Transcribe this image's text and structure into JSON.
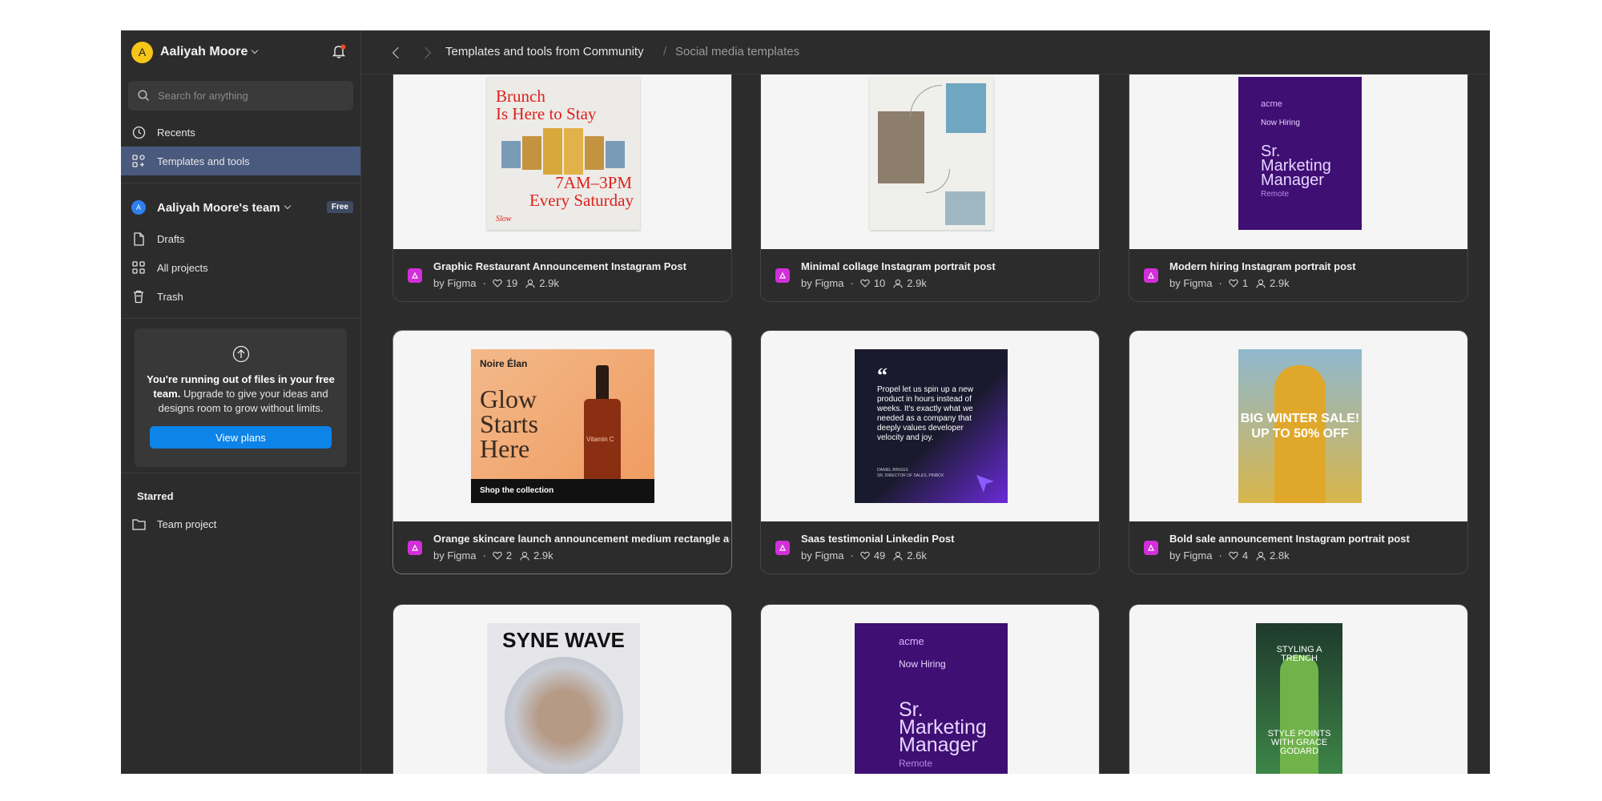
{
  "user": {
    "initial": "A",
    "name": "Aaliyah Moore"
  },
  "search": {
    "placeholder": "Search for anything"
  },
  "nav": {
    "recents": "Recents",
    "templates": "Templates and tools"
  },
  "team": {
    "initial": "A",
    "name": "Aaliyah Moore's team",
    "badge": "Free",
    "drafts": "Drafts",
    "all_projects": "All projects",
    "trash": "Trash"
  },
  "upgrade": {
    "bold": "You're running out of files in your free team.",
    "text": " Upgrade to give your ideas and designs room to grow without limits.",
    "button": "View plans"
  },
  "starred": {
    "title": "Starred",
    "items": [
      "Team project"
    ]
  },
  "breadcrumb": {
    "parent": "Templates and tools from Community",
    "separator": "/",
    "current": "Social media templates"
  },
  "colors": {
    "accent": "#0d84e8",
    "active_nav": "#4a5a7e",
    "figma_icon": "#d32fd9"
  },
  "cards": [
    {
      "title": "Graphic Restaurant Announcement Instagram Post",
      "by": "by Figma",
      "likes": "19",
      "users": "2.9k",
      "poster": {
        "l1": "Brunch",
        "l2": "Is Here to Stay",
        "l3": "7AM–3PM",
        "l4": "Every Saturday",
        "brand": "Slow"
      }
    },
    {
      "title": "Minimal collage Instagram portrait post",
      "by": "by Figma",
      "likes": "10",
      "users": "2.9k"
    },
    {
      "title": "Modern hiring Instagram portrait post",
      "by": "by Figma",
      "likes": "1",
      "users": "2.9k",
      "poster": {
        "brand": "acme",
        "l1": "Now Hiring",
        "l2": "Sr.",
        "l3": "Marketing",
        "l4": "Manager",
        "l5": "Remote"
      }
    },
    {
      "title": "Orange skincare launch announcement medium rectangle ad",
      "by": "by Figma",
      "likes": "2",
      "users": "2.9k",
      "poster": {
        "brand": "Noire Élan",
        "l1": "Glow",
        "l2": "Starts",
        "l3": "Here",
        "cta": "Shop the collection",
        "bottle": "Vitamin C"
      }
    },
    {
      "title": "Saas testimonial Linkedin Post",
      "by": "by Figma",
      "likes": "49",
      "users": "2.6k",
      "poster": {
        "quote": "Propel let us spin up a new product in hours instead of weeks. It's exactly what we needed as a company that deeply values developer velocity and joy.",
        "name": "DANIEL BRIGGS",
        "role": "SR. DIRECTOR OF SALES, PINBOX"
      }
    },
    {
      "title": "Bold sale announcement Instagram portrait post",
      "by": "by Figma",
      "likes": "4",
      "users": "2.8k",
      "poster": {
        "l1": "BIG WINTER SALE!",
        "l2": "UP TO 50% OFF"
      }
    },
    {
      "title": "",
      "by": "",
      "likes": "",
      "users": "",
      "poster": {
        "l1": "SYNE WAVE"
      }
    },
    {
      "title": "",
      "by": "",
      "likes": "",
      "users": "",
      "poster": {
        "brand": "acme",
        "l1": "Now Hiring",
        "l2": "Sr.",
        "l3": "Marketing",
        "l4": "Manager",
        "l5": "Remote"
      }
    },
    {
      "title": "",
      "by": "",
      "likes": "",
      "users": "",
      "poster": {
        "l1": "STYLING A TRENCH",
        "l2": "STYLE POINTS WITH GRACE GODARD"
      }
    }
  ],
  "help": {
    "label": "?"
  }
}
